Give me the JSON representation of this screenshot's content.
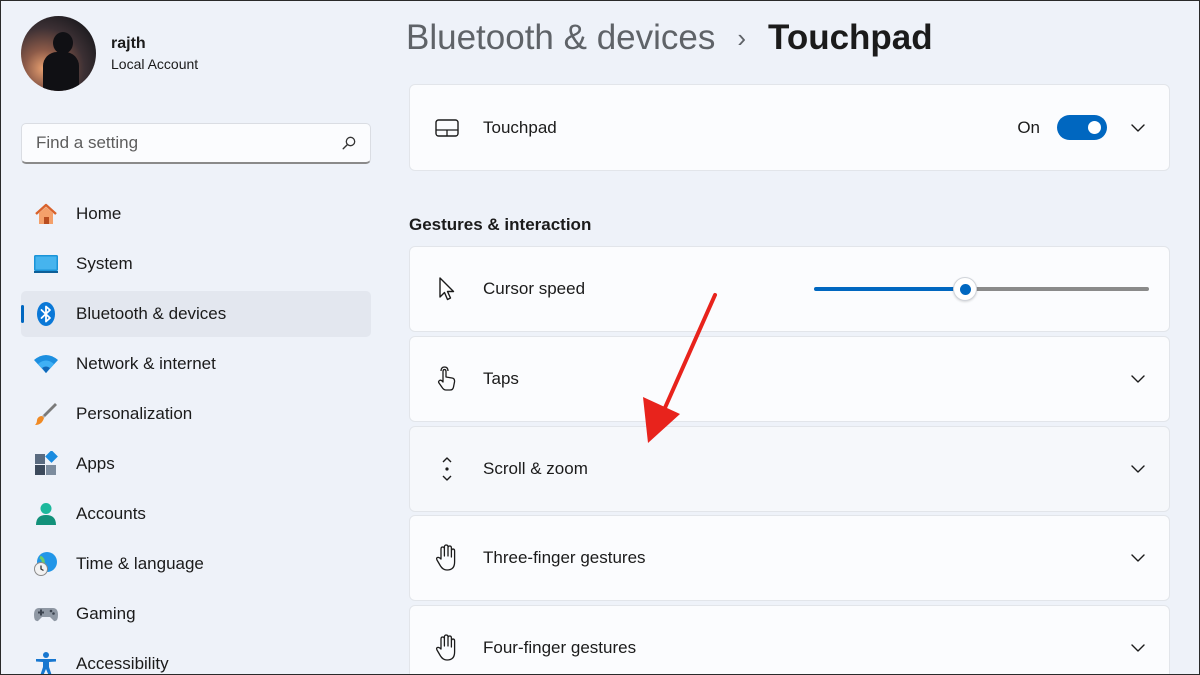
{
  "profile": {
    "name": "rajth",
    "account_type": "Local Account"
  },
  "search": {
    "placeholder": "Find a setting"
  },
  "sidebar": {
    "items": [
      {
        "label": "Home",
        "icon": "home-icon"
      },
      {
        "label": "System",
        "icon": "system-icon"
      },
      {
        "label": "Bluetooth & devices",
        "icon": "bluetooth-icon",
        "active": true
      },
      {
        "label": "Network & internet",
        "icon": "wifi-icon"
      },
      {
        "label": "Personalization",
        "icon": "brush-icon"
      },
      {
        "label": "Apps",
        "icon": "apps-icon"
      },
      {
        "label": "Accounts",
        "icon": "accounts-icon"
      },
      {
        "label": "Time & language",
        "icon": "time-language-icon"
      },
      {
        "label": "Gaming",
        "icon": "gamepad-icon"
      },
      {
        "label": "Accessibility",
        "icon": "accessibility-icon"
      }
    ]
  },
  "breadcrumb": {
    "parent": "Bluetooth & devices",
    "separator": "›",
    "current": "Touchpad"
  },
  "touchpad_card": {
    "label": "Touchpad",
    "state_label": "On",
    "enabled": true
  },
  "section": {
    "title": "Gestures & interaction"
  },
  "settings": [
    {
      "label": "Cursor speed",
      "icon": "cursor-icon"
    },
    {
      "label": "Taps",
      "icon": "tap-icon"
    },
    {
      "label": "Scroll & zoom",
      "icon": "scroll-icon"
    },
    {
      "label": "Three-finger gestures",
      "icon": "hand-icon"
    },
    {
      "label": "Four-finger gestures",
      "icon": "hand-icon"
    }
  ],
  "cursor_speed": {
    "level": 0.45
  },
  "colors": {
    "accent": "#0067c0",
    "annotation_arrow": "#e8231c",
    "background": "#eef2f9"
  }
}
